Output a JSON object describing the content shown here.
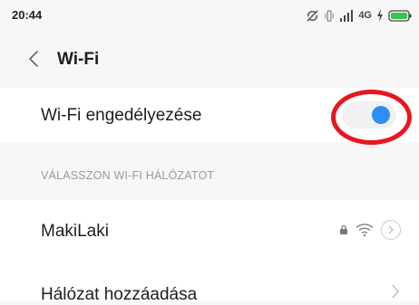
{
  "status_bar": {
    "time": "20:44",
    "network_label": "4G",
    "icons": [
      "sync-off-icon",
      "vibrate-icon",
      "signal-icon",
      "charging-icon",
      "battery-icon"
    ]
  },
  "header": {
    "back_icon": "chevron-left-icon",
    "title": "Wi-Fi"
  },
  "wifi_toggle": {
    "label": "Wi-Fi engedélyezése",
    "enabled": true,
    "accent_color": "#2e8ef4",
    "highlight_color": "#e8161d"
  },
  "networks_section": {
    "header": "VÁLASSZON WI-FI HÁLÓZATOT",
    "networks": [
      {
        "name": "MakiLaki",
        "secured": true,
        "icons": [
          "lock-icon",
          "wifi-icon",
          "chevron-right-icon"
        ]
      }
    ]
  },
  "add_network": {
    "label": "Hálózat hozzáadása",
    "icon": "chevron-right-icon"
  }
}
